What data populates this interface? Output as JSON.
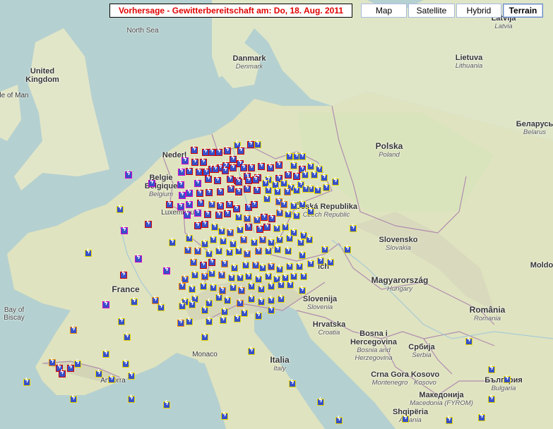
{
  "title": "Vorhersage - Gewitterbereitschaft am: Do, 18. Aug. 2011",
  "map_types": [
    {
      "label": "Map",
      "active": false
    },
    {
      "label": "Satellite",
      "active": false
    },
    {
      "label": "Hybrid",
      "active": false
    },
    {
      "label": "Terrain",
      "active": true
    }
  ],
  "labels": {
    "north_sea": "North Sea",
    "uk": "United Kingdom",
    "isle_of_man": "le of Man",
    "denmark": "Danmark",
    "denmark_sub": "Denmark",
    "latvija": "Latvija",
    "latvia": "Latvia",
    "lietuva": "Lietuva",
    "lithuania": "Lithuania",
    "belarus": "Беларусь",
    "belarus_sub": "Belarus",
    "polska": "Polska",
    "poland": "Poland",
    "netherlands": "Nederl",
    "belgium": "Belgie",
    "belgium2": "Belgique",
    "belgium_sub": "Belgium",
    "lux": "Luxembourg",
    "czech": "Česká Republika",
    "czech_sub": "Czech Republic",
    "slovensko": "Slovensko",
    "slovakia": "Slovakia",
    "france": "France",
    "bay": "Bay of Biscay",
    "bay_line1": "Bay of",
    "bay_line2": "Biscay",
    "magyar": "Magyarország",
    "hungary": "Hungary",
    "moldova": "Moldo",
    "slovenija": "Slovenija",
    "slovenia": "Slovenia",
    "hrvatska": "Hrvatska",
    "croatia": "Croatia",
    "romania": "România",
    "romania_sub": "Romania",
    "bosnia": "Bosna i Hercegovina",
    "bosnia1": "Bosna i",
    "bosnia2": "Hercegovina",
    "bosnia_sub": "Bosnia and Herzegovina",
    "bosnia_sub1": "Bosnia and",
    "bosnia_sub2": "Herzegovina",
    "srbija": "Србија",
    "serbia": "Serbia",
    "italia": "Italia",
    "italy": "Italy",
    "monaco": "Monaco",
    "andorra": "Andorra",
    "crna_gora": "Crna Gora",
    "kosova": "Kosovo",
    "montenegro": "Montenegro",
    "kosovo_sub": "Kosovo",
    "bulgaria": "България",
    "bulgaria_sub": "Bulgaria",
    "macedonia": "Македонија",
    "macedonia_sub": "Macedonia (FYROM)",
    "albania": "Shqipëria",
    "albania_sub": "Albania",
    "sterreich": "ich"
  },
  "colors": {
    "icon_fill": "#3750c8",
    "level_yellow": "#e8d800",
    "level_orange": "#f28c00",
    "level_red": "#d40000",
    "level_magenta": "#d400c8",
    "title_text": "#e00000"
  },
  "icon_name": "thunderstorm-icon"
}
